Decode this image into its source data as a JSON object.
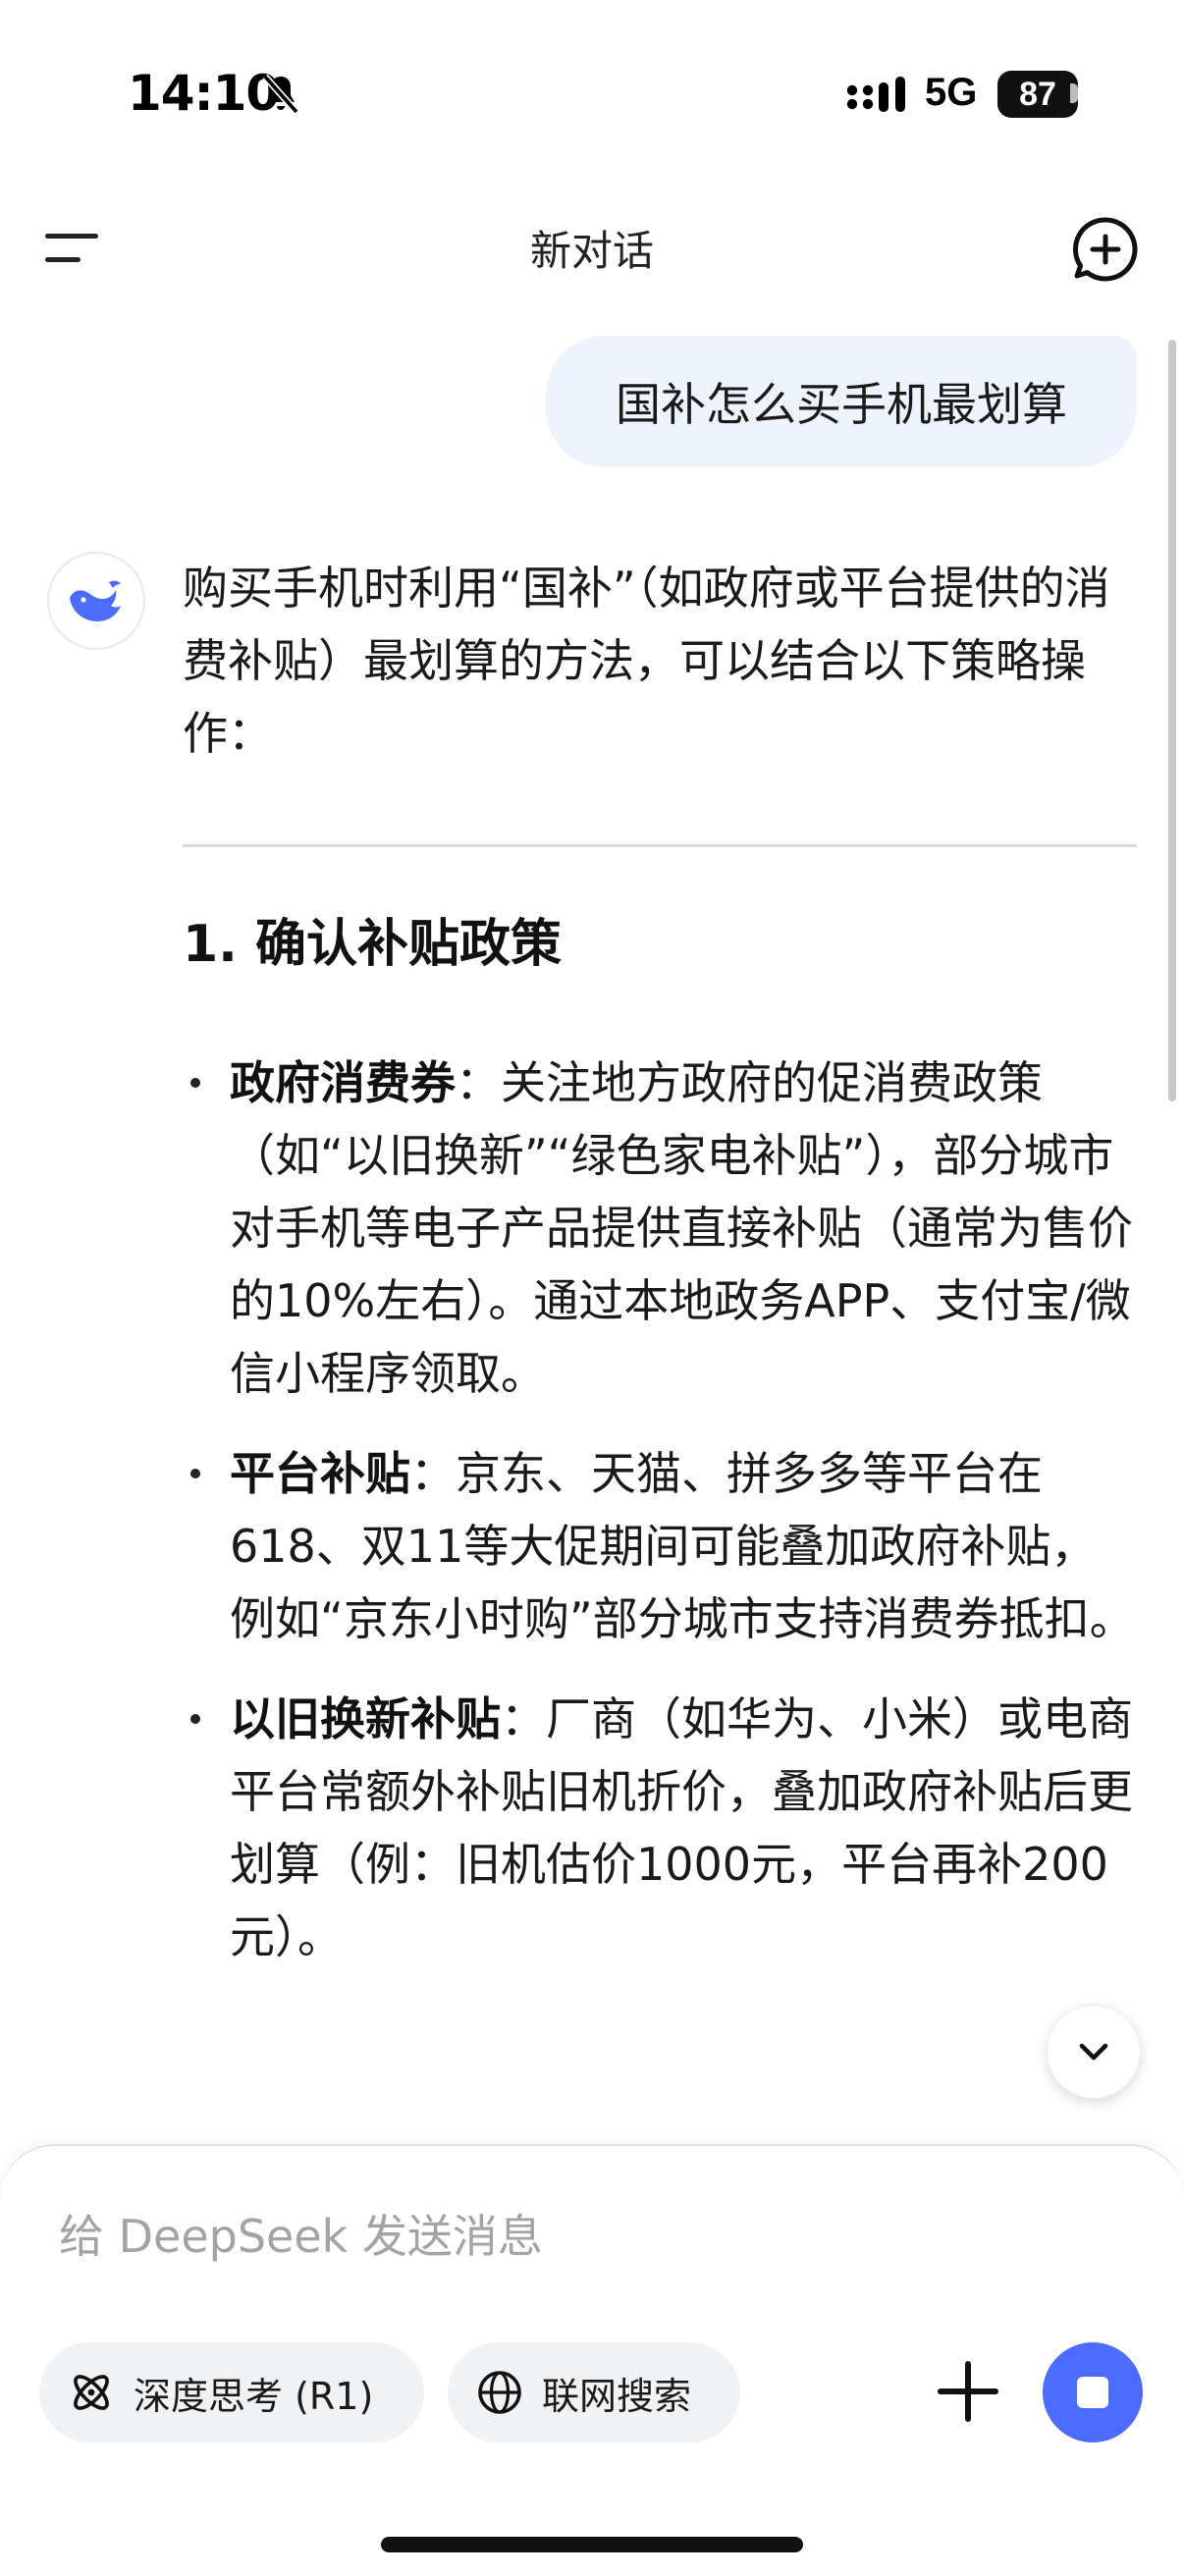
{
  "status_bar": {
    "time": "14:10",
    "network": "5G",
    "battery": "87"
  },
  "header": {
    "title": "新对话"
  },
  "user_message": "国补怎么买手机最划算",
  "assistant": {
    "intro": "购买手机时利用“国补”（如政府或平台提供的消费补贴）最划算的方法，可以结合以下策略操作：",
    "section_title": "1. 确认补贴政策",
    "bullets": [
      {
        "title": "政府消费券",
        "text": "：关注地方政府的促消费政策（如“以旧换新”“绿色家电补贴”），部分城市对手机等电子产品提供直接补贴（通常为售价的10%左右）。通过本地政务APP、支付宝/微信小程序领取。"
      },
      {
        "title": "平台补贴",
        "text": "：京东、天猫、拼多多等平台在618、双11等大促期间可能叠加政府补贴，例如“京东小时购”部分城市支持消费券抵扣。"
      },
      {
        "title": "以旧换新补贴",
        "text": "：厂商（如华为、小米）或电商平台常额外补贴旧机折价，叠加政府补贴后更划算（例：旧机估价1000元，平台再补200元）。"
      }
    ]
  },
  "composer": {
    "placeholder": "给 DeepSeek 发送消息",
    "deep_think_label": "深度思考 (R1)",
    "web_search_label": "联网搜索"
  },
  "colors": {
    "accent": "#4d6bfe",
    "user_bubble": "#eff3fc"
  },
  "icons": {
    "menu": "menu-icon",
    "new_chat": "new-chat-icon",
    "avatar": "deepseek-whale-icon",
    "scroll_down": "chevron-down-icon",
    "deep_think": "atom-icon",
    "web_search": "globe-icon",
    "attach": "plus-icon",
    "stop": "stop-icon"
  }
}
